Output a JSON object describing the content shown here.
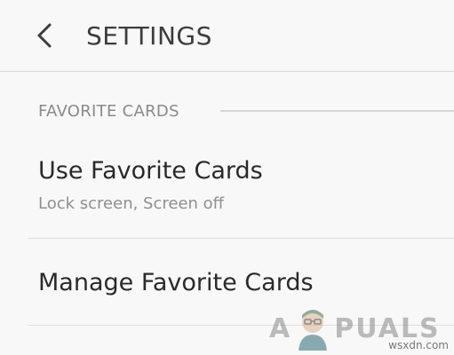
{
  "header": {
    "title": "SETTINGS",
    "back_icon": "chevron-left-icon"
  },
  "section": {
    "title": "FAVORITE CARDS"
  },
  "items": [
    {
      "title": "Use Favorite Cards",
      "subtitle": "Lock screen, Screen off"
    },
    {
      "title": "Manage Favorite Cards"
    }
  ],
  "watermark": {
    "left": "A",
    "right": "PUALS",
    "site": "wsxdn.com"
  },
  "colors": {
    "background": "#f8f8f8",
    "title_text": "#3c3c3c",
    "section_text": "#8a8a8a",
    "item_text": "#2a2a2a",
    "subtitle_text": "#8f8f8f",
    "divider": "#dedede"
  }
}
